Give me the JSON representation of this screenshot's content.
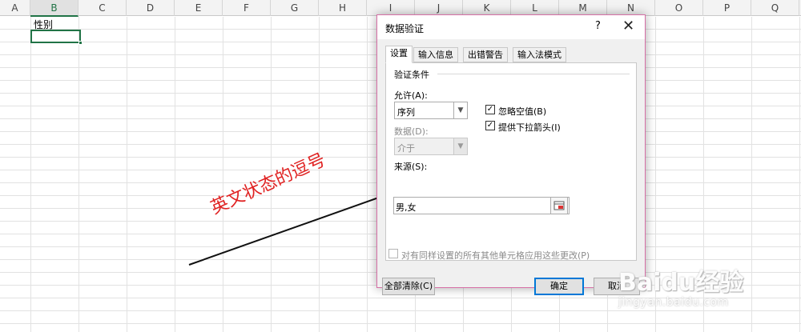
{
  "spreadsheet": {
    "columns": [
      "A",
      "B",
      "C",
      "D",
      "E",
      "F",
      "G",
      "H",
      "I",
      "J",
      "K",
      "L",
      "M",
      "N",
      "O",
      "P",
      "Q"
    ],
    "active_column": "B",
    "b1_value": "性别"
  },
  "dialog": {
    "title": "数据验证",
    "help_glyph": "?",
    "close_glyph": "✕",
    "tabs": [
      {
        "label": "设置",
        "active": true
      },
      {
        "label": "输入信息",
        "active": false
      },
      {
        "label": "出错警告",
        "active": false
      },
      {
        "label": "输入法模式",
        "active": false
      }
    ],
    "group_title": "验证条件",
    "allow_label": "允许(A):",
    "allow_value": "序列",
    "data_label": "数据(D):",
    "data_value": "介于",
    "ignore_blank_label": "忽略空值(B)",
    "ignore_blank_checked": true,
    "dropdown_label": "提供下拉箭头(I)",
    "dropdown_checked": true,
    "source_label": "来源(S):",
    "source_value": "男,女",
    "apply_all_label": "对有同样设置的所有其他单元格应用这些更改(P)",
    "apply_all_checked": false,
    "clear_all_label": "全部清除(C)",
    "ok_label": "确定",
    "cancel_label": "取消"
  },
  "annotation": {
    "text": "英文状态的逗号",
    "color": "#e02222"
  },
  "watermark": {
    "brand": "Baidu经验",
    "url": "jingyan.baidu.com"
  }
}
